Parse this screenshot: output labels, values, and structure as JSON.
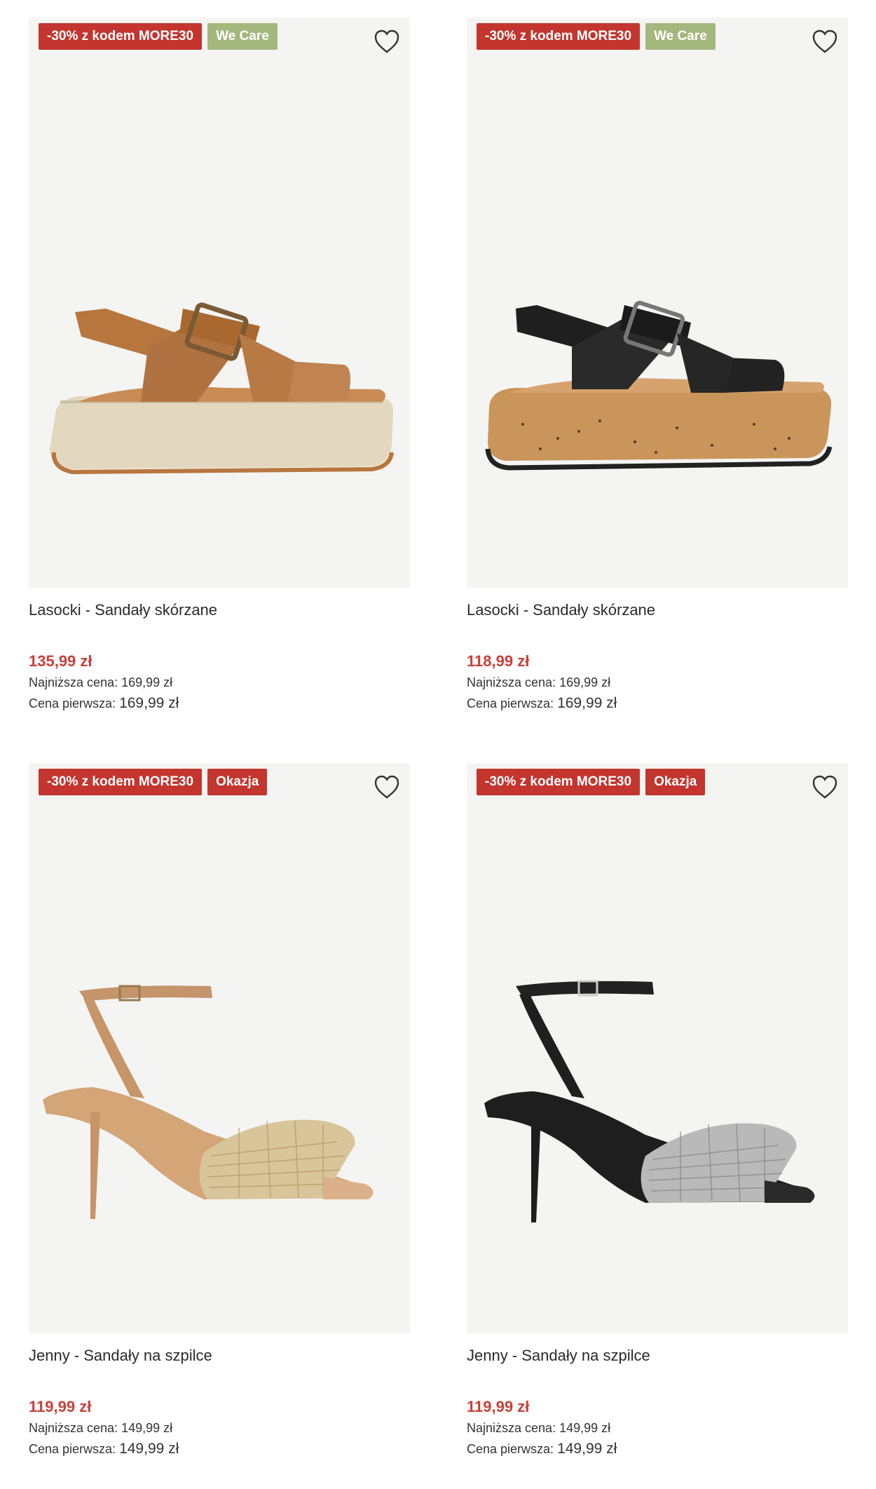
{
  "colors": {
    "promo_badge": "#c3352e",
    "care_badge": "#a4b77d",
    "price": "#c8403a",
    "image_bg": "#f4f4f3"
  },
  "products": [
    {
      "badge_promo": "-30% z kodem MORE30",
      "badge_secondary": "We Care",
      "name": "Lasocki - Sandały skórzane",
      "price": "135,99 zł",
      "lowest_label": "Najniższa cena:",
      "lowest_value": "169,99 zł",
      "first_label": "Cena pierwsza:",
      "first_value": "169,99 zł",
      "icon": "heart-outline-icon"
    },
    {
      "badge_promo": "-30% z kodem MORE30",
      "badge_secondary": "We Care",
      "name": "Lasocki - Sandały skórzane",
      "price": "118,99 zł",
      "lowest_label": "Najniższa cena:",
      "lowest_value": "169,99 zł",
      "first_label": "Cena pierwsza:",
      "first_value": "169,99 zł",
      "icon": "heart-outline-icon"
    },
    {
      "badge_promo": "-30% z kodem MORE30",
      "badge_secondary": "Okazja",
      "name": "Jenny - Sandały na szpilce",
      "price": "119,99 zł",
      "lowest_label": "Najniższa cena:",
      "lowest_value": "149,99 zł",
      "first_label": "Cena pierwsza:",
      "first_value": "149,99 zł",
      "icon": "heart-outline-icon"
    },
    {
      "badge_promo": "-30% z kodem MORE30",
      "badge_secondary": "Okazja",
      "name": "Jenny - Sandały na szpilce",
      "price": "119,99 zł",
      "lowest_label": "Najniższa cena:",
      "lowest_value": "149,99 zł",
      "first_label": "Cena pierwsza:",
      "first_value": "149,99 zł",
      "icon": "heart-outline-icon"
    }
  ]
}
